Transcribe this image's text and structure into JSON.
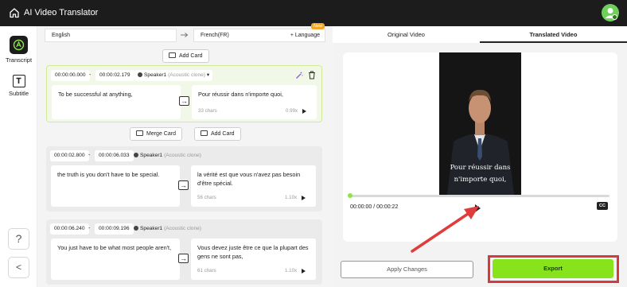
{
  "app": {
    "title": "AI Video Translator"
  },
  "sidebar": {
    "transcript_label": "Transcript",
    "subtitle_label": "Subtitle",
    "help_label": "?",
    "collapse_label": "<"
  },
  "languages": {
    "source": "English",
    "target": "French(FR)",
    "add_language_label": "+ Language",
    "new_badge": "New"
  },
  "buttons": {
    "add_card": "Add Card",
    "merge_card": "Merge Card",
    "add_card_2": "Add Card"
  },
  "cards": [
    {
      "start": "00:00:00.000",
      "end": "00:00:02.179",
      "speaker": "Speaker1",
      "clone": "(Acoustic clone)",
      "source_text": "To be successful at anything,",
      "translated_text": "Pour réussir dans n'importe quoi,",
      "chars": "33 chars",
      "speed": "0.99x"
    },
    {
      "start": "00:00:02.800",
      "end": "00:00:06.033",
      "speaker": "Speaker1",
      "clone": "(Acoustic clone)",
      "source_text": "the truth is you don't have to be special.",
      "translated_text": "la vérité est que vous n'avez pas besoin d'être spécial.",
      "chars": "56 chars",
      "speed": "1.10x"
    },
    {
      "start": "00:00:06.240",
      "end": "00:00:09.196",
      "speaker": "Speaker1",
      "clone": "(Acoustic clone)",
      "source_text": "You just have to be what most people aren't,",
      "translated_text": "Vous devez juste être ce que la plupart des gens ne sont pas,",
      "chars": "61 chars",
      "speed": "1.10x"
    }
  ],
  "tabs": {
    "original": "Original Video",
    "translated": "Translated Video"
  },
  "player": {
    "subtitle_line1": "Pour réussir dans",
    "subtitle_line2": "n'importe quoi,",
    "time": "00:00:00 / 00:00:22",
    "cc_label": "CC",
    "progress": 0
  },
  "actions": {
    "apply_changes": "Apply Changes",
    "export": "Export"
  },
  "colors": {
    "accent_green": "#87e41c",
    "highlight_red": "#d63a3a",
    "topbar": "#1c1c1c"
  }
}
